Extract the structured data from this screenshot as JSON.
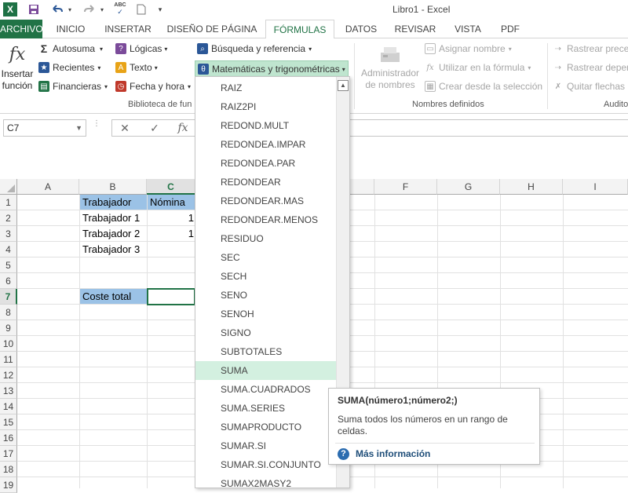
{
  "window": {
    "title": "Libro1 - Excel",
    "app_icon_letter": "X"
  },
  "quick_access": {
    "save_icon": "save-icon",
    "undo_icon": "undo-icon",
    "redo_icon": "redo-icon",
    "spelling_icon": "spelling-icon",
    "spelling_label": "ABC",
    "new_icon": "new-document-icon",
    "customize_icon": "customize-arrow-icon"
  },
  "tabs": [
    {
      "label": "ARCHIVO"
    },
    {
      "label": "INICIO"
    },
    {
      "label": "INSERTAR"
    },
    {
      "label": "DISEÑO DE PÁGINA"
    },
    {
      "label": "FÓRMULAS"
    },
    {
      "label": "DATOS"
    },
    {
      "label": "REVISAR"
    },
    {
      "label": "VISTA"
    },
    {
      "label": "PDF"
    }
  ],
  "ribbon": {
    "insert_function": {
      "symbol": "fx",
      "line1": "Insertar",
      "line2": "función"
    },
    "library": {
      "autosuma": "Autosuma",
      "recientes": "Recientes",
      "financieras": "Financieras",
      "logicas": "Lógicas",
      "texto": "Texto",
      "fecha_hora": "Fecha y hora",
      "busqueda": "Búsqueda y referencia",
      "matematicas": "Matemáticas y trigonométricas",
      "group_label": "Biblioteca de fun"
    },
    "names": {
      "admin_line1": "Administrador",
      "admin_line2": "de nombres",
      "asignar": "Asignar nombre",
      "utilizar": "Utilizar en la fórmula",
      "crear": "Crear desde la selección",
      "group_label": "Nombres definidos"
    },
    "audit": {
      "rastrear_prec": "Rastrear preced",
      "rastrear_dep": "Rastrear depen",
      "quitar": "Quitar flechas",
      "group_label": "Audito"
    }
  },
  "formula_bar": {
    "name_box": "C7",
    "cancel_symbol": "✕",
    "enter_symbol": "✓",
    "fx_symbol": "fx",
    "value": ""
  },
  "grid": {
    "columns": [
      "A",
      "B",
      "C",
      "F",
      "G",
      "H",
      "I"
    ],
    "rows": [
      "1",
      "2",
      "3",
      "4",
      "5",
      "6",
      "7",
      "8",
      "9",
      "10",
      "11",
      "12",
      "13",
      "14",
      "15",
      "16",
      "17",
      "18",
      "19"
    ],
    "cells": {
      "b1": "Trabajador",
      "c1": "Nómina",
      "b2": "Trabajador 1",
      "b3": "Trabajador 2",
      "b4": "Trabajador 3",
      "b7": "Coste total",
      "c2_frag": "1",
      "c3_frag": "1"
    },
    "selected_cell": "C7"
  },
  "dropdown": {
    "items": [
      "RAIZ",
      "RAIZ2PI",
      "REDOND.MULT",
      "REDONDEA.IMPAR",
      "REDONDEA.PAR",
      "REDONDEAR",
      "REDONDEAR.MAS",
      "REDONDEAR.MENOS",
      "RESIDUO",
      "SEC",
      "SECH",
      "SENO",
      "SENOH",
      "SIGNO",
      "SUBTOTALES",
      "SUMA",
      "SUMA.CUADRADOS",
      "SUMA.SERIES",
      "SUMAPRODUCTO",
      "SUMAR.SI",
      "SUMAR.SI.CONJUNTO",
      "SUMAX2MASY2"
    ],
    "highlighted": "SUMA"
  },
  "tooltip": {
    "title": "SUMA(número1;número2;)",
    "description": "Suma todos los números en un rango de celdas.",
    "link": "Más información",
    "help_icon_symbol": "?"
  },
  "colors": {
    "accent": "#217346",
    "header_fill": "#9bc2e6",
    "highlight": "#d3f0e0"
  }
}
